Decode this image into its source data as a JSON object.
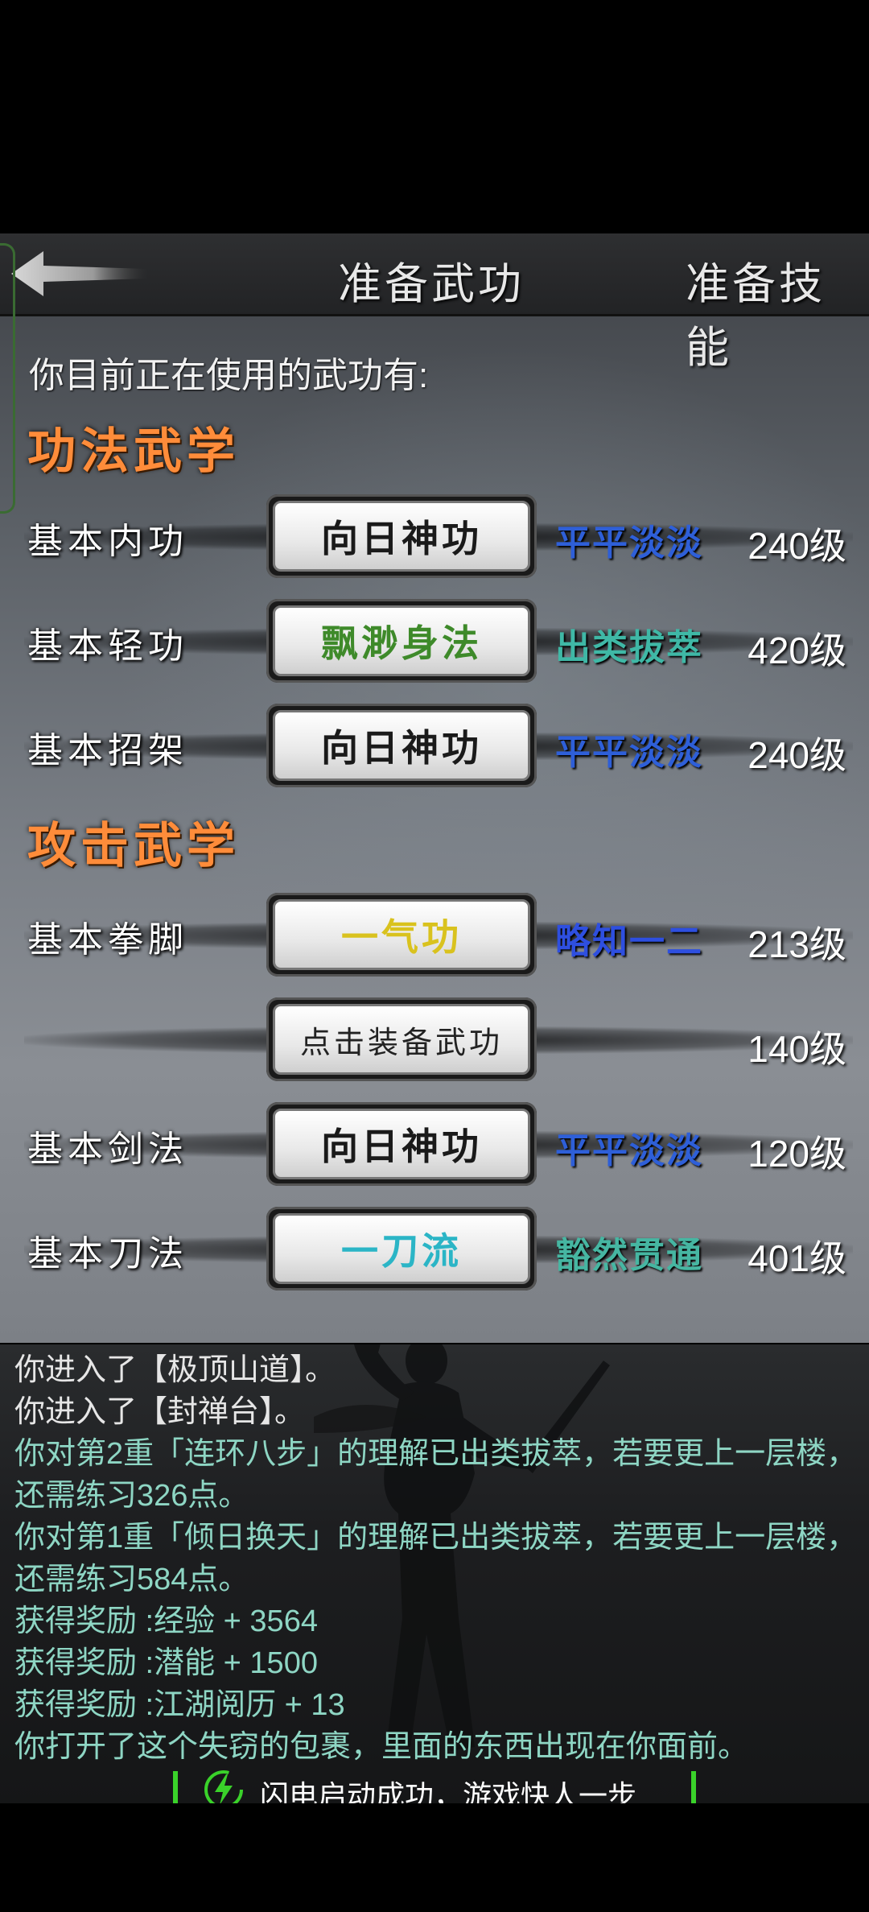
{
  "header": {
    "title": "准备武功",
    "right_tab": "准备技能",
    "back_icon": "back-arrow-icon"
  },
  "intro": "你目前正在使用的武功有:",
  "sections": [
    {
      "title": "功法武学",
      "rows": [
        {
          "category": "基本内功",
          "skill": "向日神功",
          "skill_color": "#1a1a1a",
          "rank": "平平淡淡",
          "rank_color": "#2e5fd8",
          "level": "240级"
        },
        {
          "category": "基本轻功",
          "skill": "飘渺身法",
          "skill_color": "#3e8a2a",
          "rank": "出类拔萃",
          "rank_color": "#3fb8a6",
          "level": "420级"
        },
        {
          "category": "基本招架",
          "skill": "向日神功",
          "skill_color": "#1a1a1a",
          "rank": "平平淡淡",
          "rank_color": "#2e5fd8",
          "level": "240级"
        }
      ]
    },
    {
      "title": "攻击武学",
      "rows": [
        {
          "category": "基本拳脚",
          "skill": "一气功",
          "skill_color": "#d9c21e",
          "rank": "略知一二",
          "rank_color": "#2e4fe0",
          "level": "213级"
        },
        {
          "category": "",
          "skill": "点击装备武功",
          "skill_color": "#222222",
          "rank": "",
          "rank_color": "#2e5fd8",
          "level": "140级",
          "placeholder": true
        },
        {
          "category": "基本剑法",
          "skill": "向日神功",
          "skill_color": "#1a1a1a",
          "rank": "平平淡淡",
          "rank_color": "#2e5fd8",
          "level": "120级"
        },
        {
          "category": "基本刀法",
          "skill": "一刀流",
          "skill_color": "#2bb5c6",
          "rank": "豁然贯通",
          "rank_color": "#46b6a2",
          "level": "401级"
        }
      ]
    }
  ],
  "log": [
    {
      "text": "你进入了【极顶山道】。",
      "style": "white"
    },
    {
      "text": "你进入了【封禅台】。",
      "style": "white"
    },
    {
      "text": "你对第2重「连环八步」的理解已出类拔萃，若要更上一层楼，还需练习326点。",
      "style": "teal"
    },
    {
      "text": "你对第1重「倾日换天」的理解已出类拔萃，若要更上一层楼，还需练习584点。",
      "style": "teal"
    },
    {
      "text": "获得奖励 :经验 + 3564",
      "style": "teal"
    },
    {
      "text": "获得奖励 :潜能 + 1500",
      "style": "teal"
    },
    {
      "text": "获得奖励 :江湖阅历 + 13",
      "style": "teal"
    },
    {
      "text": "你打开了这个失窃的包裹，里面的东西出现在你面前。",
      "style": "teal"
    }
  ],
  "toast": {
    "text": "闪电启动成功，游戏快人一步",
    "icon": "lightning-icon",
    "accent": "#3ad22a"
  }
}
